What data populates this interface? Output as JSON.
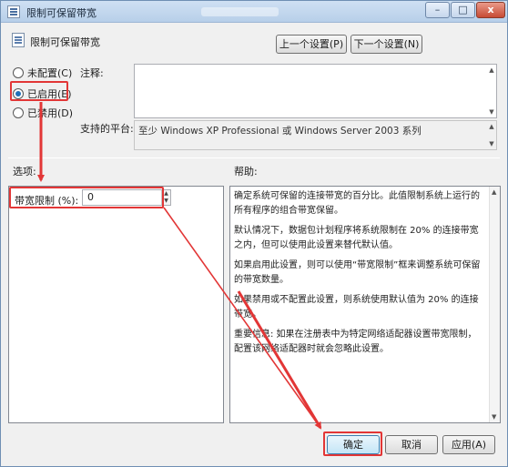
{
  "window": {
    "title": "限制可保留带宽",
    "controls": {
      "minimize": "–",
      "maximize": "□",
      "close": "x"
    }
  },
  "header": {
    "policy_name": "限制可保留带宽",
    "prev_setting_label": "上一个设置(P)",
    "next_setting_label": "下一个设置(N)"
  },
  "state": {
    "options": [
      {
        "label": "未配置(C)",
        "checked": false
      },
      {
        "label": "已启用(E)",
        "checked": true
      },
      {
        "label": "已禁用(D)",
        "checked": false
      }
    ]
  },
  "comment": {
    "label": "注释:",
    "value": ""
  },
  "platform": {
    "label": "支持的平台:",
    "value": "至少 Windows XP Professional 或 Windows Server 2003 系列"
  },
  "options_section": {
    "label": "选项:",
    "bandwidth_label": "带宽限制 (%):",
    "bandwidth_value": "0"
  },
  "help_section": {
    "label": "帮助:",
    "paragraphs": [
      "确定系统可保留的连接带宽的百分比。此值限制系统上运行的所有程序的组合带宽保留。",
      "默认情况下，数据包计划程序将系统限制在 20% 的连接带宽之内，但可以使用此设置来替代默认值。",
      "如果启用此设置，则可以使用“带宽限制”框来调整系统可保留的带宽数量。",
      "如果禁用或不配置此设置，则系统使用默认值为 20% 的连接带宽。",
      "重要信息: 如果在注册表中为特定网络适配器设置带宽限制，配置该网络适配器时就会忽略此设置。"
    ]
  },
  "footer": {
    "ok_label": "确定",
    "cancel_label": "取消",
    "apply_label": "应用(A)"
  },
  "annotation_color": "#e23636"
}
